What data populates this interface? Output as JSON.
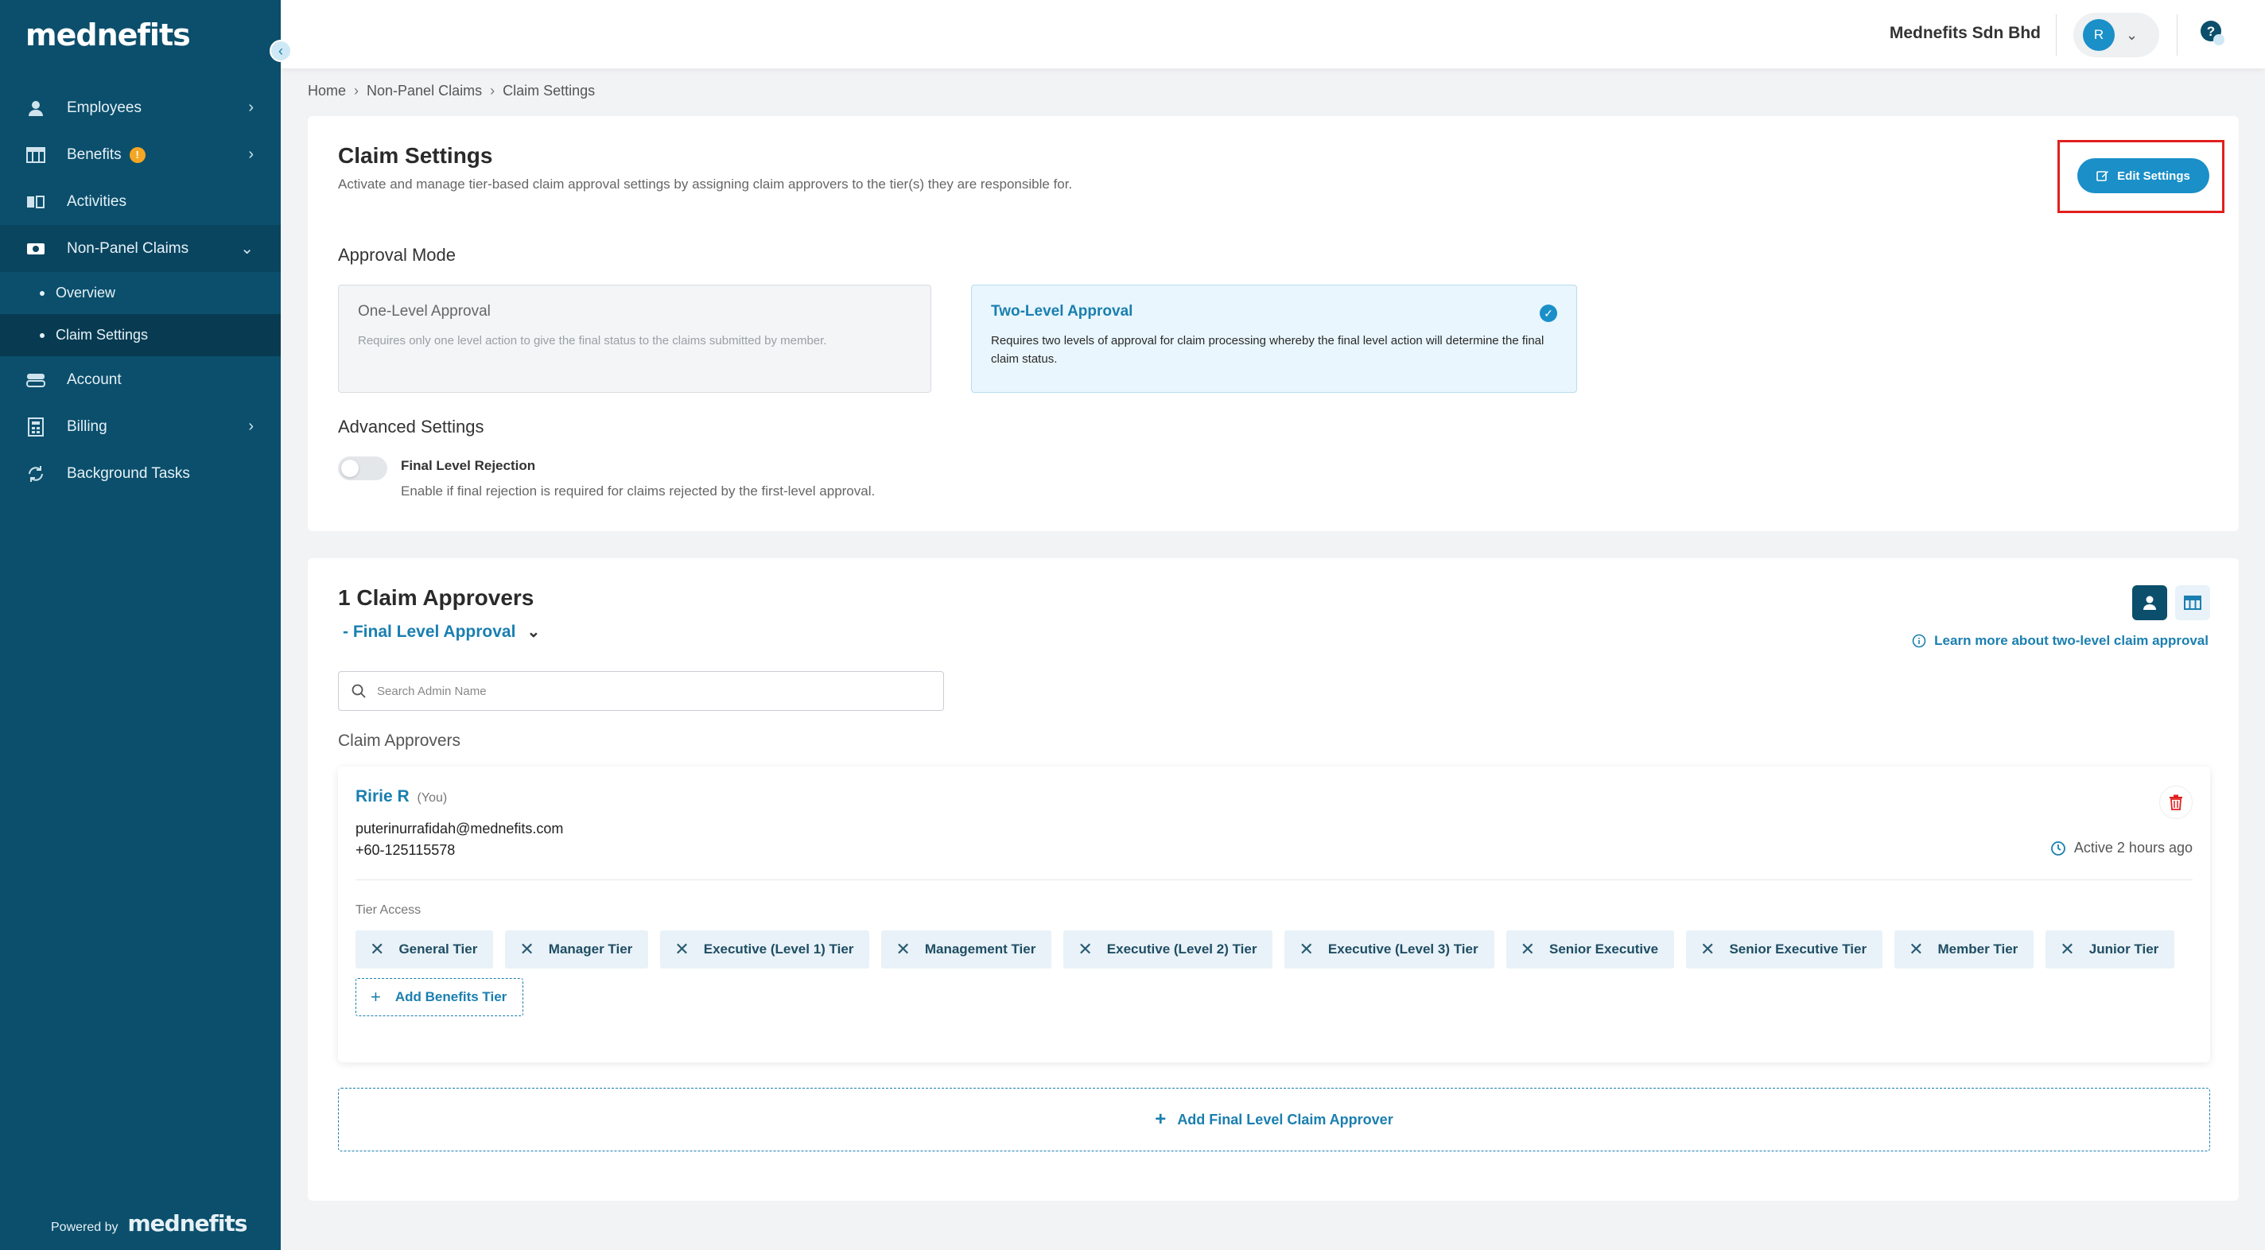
{
  "sidebar": {
    "logo": "mednefits",
    "items": [
      {
        "label": "Employees"
      },
      {
        "label": "Benefits",
        "badge": "!"
      },
      {
        "label": "Activities"
      },
      {
        "label": "Non-Panel Claims"
      },
      {
        "label": "Account"
      },
      {
        "label": "Billing"
      },
      {
        "label": "Background Tasks"
      }
    ],
    "sub_items": [
      {
        "label": "Overview"
      },
      {
        "label": "Claim Settings"
      }
    ],
    "powered_label": "Powered by",
    "powered_brand": "mednefits"
  },
  "topbar": {
    "company": "Mednefits Sdn Bhd",
    "avatar_initial": "R"
  },
  "breadcrumb": [
    "Home",
    "Non-Panel Claims",
    "Claim Settings"
  ],
  "settings": {
    "title": "Claim Settings",
    "description": "Activate and manage tier-based claim approval settings by assigning claim approvers to the tier(s) they are responsible for.",
    "edit_button": "Edit Settings",
    "approval_mode_title": "Approval Mode",
    "modes": [
      {
        "title": "One-Level Approval",
        "desc": "Requires only one level action to give the final status to the claims submitted by member."
      },
      {
        "title": "Two-Level Approval",
        "desc": "Requires two levels of approval for claim processing whereby the final level action will determine the final claim status."
      }
    ],
    "advanced_title": "Advanced Settings",
    "toggle_label": "Final Level Rejection",
    "toggle_desc": "Enable if final rejection is required for claims rejected by the first-level approval."
  },
  "approvers": {
    "title": "1 Claim Approvers",
    "level": "- Final Level Approval",
    "learn_more": "Learn more about two-level claim approval",
    "search_placeholder": "Search Admin Name",
    "section_label": "Claim Approvers",
    "card": {
      "name": "Ririe R",
      "you": "(You)",
      "email": "puterinurrafidah@mednefits.com",
      "phone": "+60-125115578",
      "active": "Active 2 hours ago",
      "tier_access_label": "Tier Access",
      "tiers": [
        "General Tier",
        "Manager Tier",
        "Executive (Level 1) Tier",
        "Management Tier",
        "Executive (Level 2) Tier",
        "Executive (Level 3) Tier",
        "Senior Executive",
        "Senior Executive Tier",
        "Member Tier",
        "Junior Tier"
      ],
      "add_tier": "Add Benefits Tier"
    },
    "add_final": "Add Final Level Claim Approver"
  },
  "colors": {
    "sidebar": "#0b4f6c",
    "accent": "#1a8fc8",
    "highlight_box": "#e0201f"
  }
}
